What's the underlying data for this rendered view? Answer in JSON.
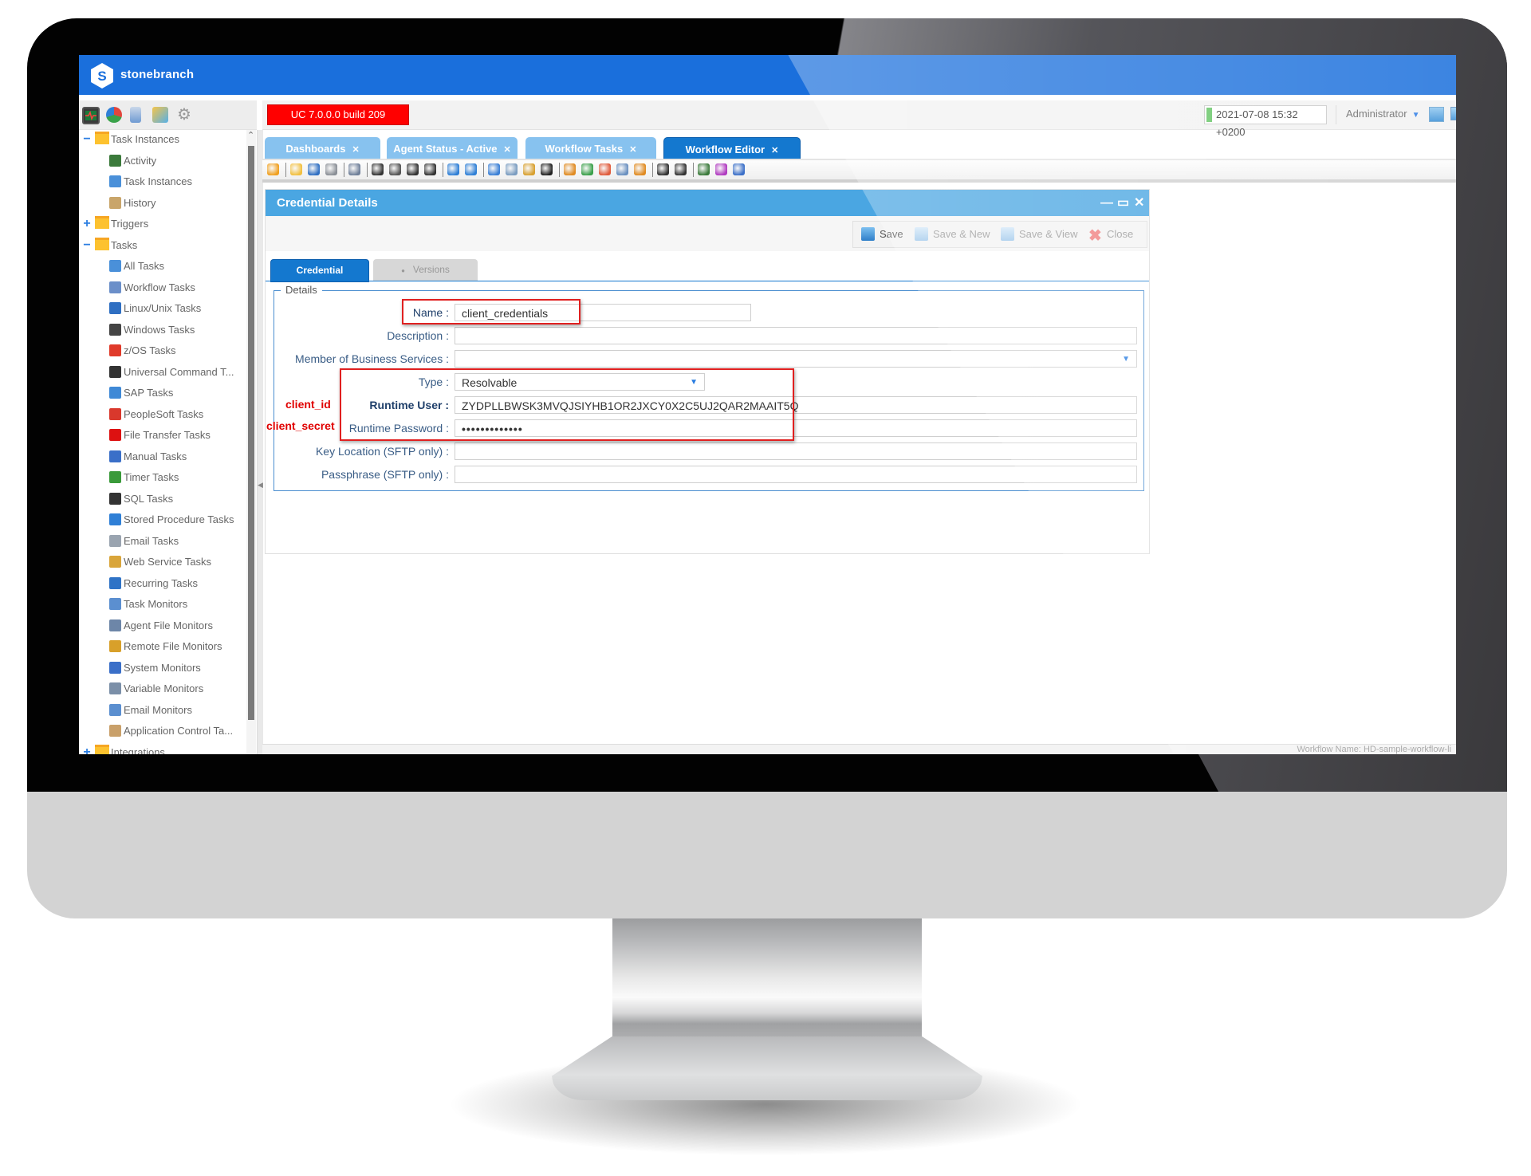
{
  "app": {
    "brand": "stonebranch",
    "version_badge": "UC 7.0.0.0 build 209",
    "datetime": "2021-07-08 15:32 +0200",
    "user": "Administrator",
    "colors": {
      "header": "#1a6fdc",
      "accent": "#1478cf",
      "badge": "#ff0000",
      "dialog_title": "#4aa6e2",
      "annotation": "#e00000"
    }
  },
  "sidebar_toolbar": {
    "icons": [
      "activity-monitor-icon",
      "pie-chart-icon",
      "reports-icon",
      "bundles-icon",
      "gear-icon"
    ]
  },
  "tree": {
    "items": [
      {
        "label": "Task Instances",
        "level": 0,
        "toggle": "−",
        "kind": "folder"
      },
      {
        "label": "Activity",
        "level": 1,
        "icon": "activity-icon"
      },
      {
        "label": "Task Instances",
        "level": 1,
        "icon": "task-instances-icon"
      },
      {
        "label": "History",
        "level": 1,
        "icon": "history-book-icon"
      },
      {
        "label": "Triggers",
        "level": 0,
        "toggle": "+",
        "kind": "folder"
      },
      {
        "label": "Tasks",
        "level": 0,
        "toggle": "−",
        "kind": "folder"
      },
      {
        "label": "All Tasks",
        "level": 1,
        "icon": "all-tasks-icon"
      },
      {
        "label": "Workflow Tasks",
        "level": 1,
        "icon": "workflow-icon"
      },
      {
        "label": "Linux/Unix Tasks",
        "level": 1,
        "icon": "linux-penguin-icon"
      },
      {
        "label": "Windows Tasks",
        "level": 1,
        "icon": "windows-logo-icon"
      },
      {
        "label": "z/OS Tasks",
        "level": 1,
        "icon": "mainframe-icon"
      },
      {
        "label": "Universal Command T...",
        "level": 1,
        "icon": "universal-command-icon"
      },
      {
        "label": "SAP Tasks",
        "level": 1,
        "icon": "sap-icon"
      },
      {
        "label": "PeopleSoft Tasks",
        "level": 1,
        "icon": "peoplesoft-icon"
      },
      {
        "label": "File Transfer Tasks",
        "level": 1,
        "icon": "file-transfer-icon"
      },
      {
        "label": "Manual Tasks",
        "level": 1,
        "icon": "manual-task-icon"
      },
      {
        "label": "Timer Tasks",
        "level": 1,
        "icon": "timer-icon"
      },
      {
        "label": "SQL Tasks",
        "level": 1,
        "icon": "sql-icon"
      },
      {
        "label": "Stored Procedure Tasks",
        "level": 1,
        "icon": "stored-procedure-icon"
      },
      {
        "label": "Email Tasks",
        "level": 1,
        "icon": "email-task-icon"
      },
      {
        "label": "Web Service Tasks",
        "level": 1,
        "icon": "web-service-icon"
      },
      {
        "label": "Recurring Tasks",
        "level": 1,
        "icon": "recurring-icon"
      },
      {
        "label": "Task Monitors",
        "level": 1,
        "icon": "task-monitor-icon"
      },
      {
        "label": "Agent File Monitors",
        "level": 1,
        "icon": "agent-file-monitor-icon"
      },
      {
        "label": "Remote File Monitors",
        "level": 1,
        "icon": "remote-file-monitor-icon"
      },
      {
        "label": "System Monitors",
        "level": 1,
        "icon": "system-monitor-icon"
      },
      {
        "label": "Variable Monitors",
        "level": 1,
        "icon": "variable-monitor-icon"
      },
      {
        "label": "Email Monitors",
        "level": 1,
        "icon": "email-monitor-icon"
      },
      {
        "label": "Application Control Ta...",
        "level": 1,
        "icon": "application-control-icon"
      },
      {
        "label": "Integrations",
        "level": 0,
        "toggle": "+",
        "kind": "folder"
      }
    ]
  },
  "tabs": [
    {
      "label": "Dashboards",
      "close": "✕",
      "active": false
    },
    {
      "label": "Agent Status - Active",
      "close": "✕",
      "active": false
    },
    {
      "label": "Workflow Tasks",
      "close": "✕",
      "active": false
    },
    {
      "label": "Workflow Editor",
      "close": "✕",
      "active": true
    }
  ],
  "workflow_toolbar": {
    "icons": [
      "up-arrow-icon",
      "sep",
      "open-folder-icon",
      "save-icon",
      "print-icon",
      "sep",
      "find-icon",
      "sep",
      "pointer-icon",
      "hand-pan-icon",
      "elbow-connector-icon",
      "straight-connector-icon",
      "sep",
      "undo-icon",
      "redo-icon",
      "sep",
      "cut-icon",
      "copy-icon",
      "paste-icon",
      "delete-icon",
      "sep",
      "zoom-icon",
      "zoom-in-icon",
      "zoom-out-icon",
      "zoom-fit-icon",
      "zoom-reset-icon",
      "sep",
      "layout-horizontal-icon",
      "layout-tree-icon",
      "sep",
      "export-icon",
      "properties-icon",
      "monitor-icon"
    ]
  },
  "dialog": {
    "title": "Credential Details",
    "controls": {
      "minimize": "—",
      "maximize": "▭",
      "close": "✕"
    },
    "actions": [
      {
        "label": "Save",
        "icon": "save-icon",
        "enabled": true
      },
      {
        "label": "Save & New",
        "icon": "save-new-icon",
        "enabled": false
      },
      {
        "label": "Save & View",
        "icon": "save-view-icon",
        "enabled": false
      },
      {
        "label": "Close",
        "icon": "close-x-icon",
        "enabled": true
      }
    ],
    "form_tabs": [
      {
        "label": "Credential",
        "active": true
      },
      {
        "label": "Versions",
        "active": false,
        "prefix": "●"
      }
    ],
    "fieldset_legend": "Details",
    "fields": [
      {
        "label": "Name :",
        "value": "client_credentials",
        "bold": false
      },
      {
        "label": "Description :",
        "value": ""
      },
      {
        "label": "Member of Business Services :",
        "value": "",
        "dropdown": true
      },
      {
        "label": "Type :",
        "value": "Resolvable",
        "dropdown": true
      },
      {
        "label": "Runtime User :",
        "value": "ZYDPLLBWSK3MVQJSIYHB1OR2JXCY0X2C5UJ2QAR2MAAIT5Q",
        "bold": true
      },
      {
        "label": "Runtime Password :",
        "value": "•••••••••••••"
      },
      {
        "label": "Key Location (SFTP only) :",
        "value": ""
      },
      {
        "label": "Passphrase (SFTP only) :",
        "value": ""
      }
    ],
    "annotations": {
      "client_id": "client_id",
      "client_secret": "client_secret"
    }
  },
  "status_bar": {
    "text": "Workflow Name: HD-sample-workflow-li"
  }
}
